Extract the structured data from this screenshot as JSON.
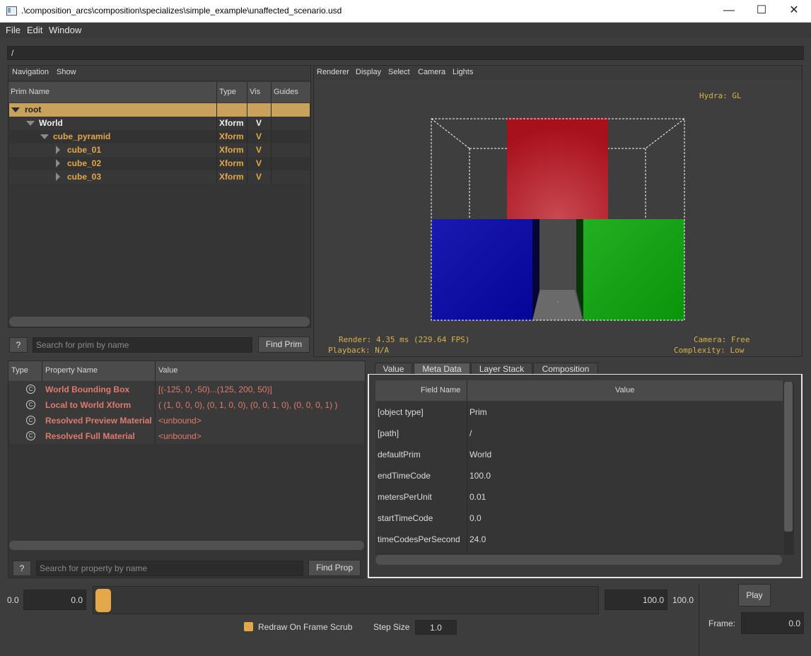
{
  "window": {
    "title": ".\\composition_arcs\\composition\\specializes\\simple_example\\unaffected_scenario.usd"
  },
  "menu": [
    "File",
    "Edit",
    "Window"
  ],
  "path": "/",
  "navigation": {
    "menu": [
      "Navigation",
      "Show"
    ],
    "columns": [
      "Prim Name",
      "Type",
      "Vis",
      "Guides"
    ],
    "rows": [
      {
        "name": "root",
        "type": "",
        "vis": ""
      },
      {
        "name": "World",
        "type": "Xform",
        "vis": "V"
      },
      {
        "name": "cube_pyramid",
        "type": "Xform",
        "vis": "V"
      },
      {
        "name": "cube_01",
        "type": "Xform",
        "vis": "V"
      },
      {
        "name": "cube_02",
        "type": "Xform",
        "vis": "V"
      },
      {
        "name": "cube_03",
        "type": "Xform",
        "vis": "V"
      }
    ],
    "help_label": "?",
    "search_placeholder": "Search for prim by name",
    "find_label": "Find Prim"
  },
  "viewport": {
    "menu": [
      "Renderer",
      "Display",
      "Select",
      "Camera",
      "Lights"
    ],
    "hydra": "Hydra: GL",
    "render": "Render: 4.35 ms (229.64 FPS)",
    "playback": "Playback: N/A",
    "camera": "Camera: Free",
    "complexity": "Complexity: Low",
    "colors": {
      "top_cube": "#b8202a",
      "left_cube": "#0a10a8",
      "right_cube": "#119a11",
      "background": "#3e3e3e",
      "hud": "#d8b24a"
    }
  },
  "properties": {
    "columns": [
      "Type",
      "Property Name",
      "Value"
    ],
    "rows": [
      {
        "icon": "C",
        "name": "World Bounding Box",
        "value": "[(-125, 0, -50)...(125, 200, 50)]"
      },
      {
        "icon": "C",
        "name": "Local to World Xform",
        "value": "( (1, 0, 0, 0), (0, 1, 0, 0), (0, 0, 1, 0), (0, 0, 0, 1) )"
      },
      {
        "icon": "C",
        "name": "Resolved Preview Material",
        "value": "<unbound>"
      },
      {
        "icon": "C",
        "name": "Resolved Full Material",
        "value": "<unbound>"
      }
    ],
    "help_label": "?",
    "search_placeholder": "Search for property by name",
    "find_label": "Find Prop"
  },
  "inspector": {
    "tabs": [
      "Value",
      "Meta Data",
      "Layer Stack",
      "Composition"
    ],
    "active_tab": "Meta Data",
    "columns": [
      "Field Name",
      "Value"
    ],
    "rows": [
      {
        "field": "[object type]",
        "value": "Prim"
      },
      {
        "field": "[path]",
        "value": "/"
      },
      {
        "field": "defaultPrim",
        "value": "World"
      },
      {
        "field": "endTimeCode",
        "value": "100.0"
      },
      {
        "field": "metersPerUnit",
        "value": "0.01"
      },
      {
        "field": "startTimeCode",
        "value": "0.0"
      },
      {
        "field": "timeCodesPerSecond",
        "value": "24.0"
      }
    ]
  },
  "timeline": {
    "start_label": "0.0",
    "start_value": "0.0",
    "end_value": "100.0",
    "end_label": "100.0",
    "play_label": "Play",
    "frame_label": "Frame:",
    "frame_value": "0.0",
    "redraw_label": "Redraw On Frame Scrub",
    "redraw_checked": true,
    "step_label": "Step Size",
    "step_value": "1.0",
    "slider_position": 0.0,
    "accent": "#e3a84a"
  }
}
